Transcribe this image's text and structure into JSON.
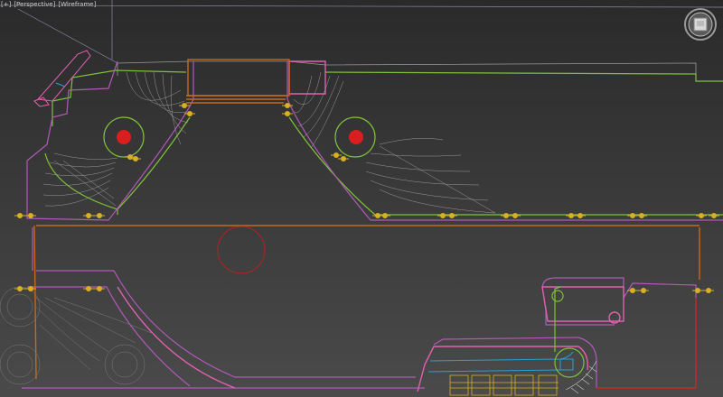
{
  "viewport": {
    "labels": [
      {
        "text": "[+]",
        "name": "viewport-menu-plus"
      },
      {
        "text": "[Perspective]",
        "name": "viewport-menu-view"
      },
      {
        "text": "[Wireframe]",
        "name": "viewport-menu-shading"
      }
    ],
    "background": "#3a3a3a"
  },
  "viewcube": {
    "icon": "viewcube-icon"
  },
  "colors": {
    "accent_red": "#d81e1e",
    "helper_yellow": "#d8b020",
    "spline_green": "#7ec23a",
    "spline_magenta": "#b05ab8",
    "spline_orange": "#c56a1a",
    "spline_pink": "#e060b0",
    "spline_blue": "#2aa0d0",
    "mesh_gray": "#8a8a8a"
  }
}
